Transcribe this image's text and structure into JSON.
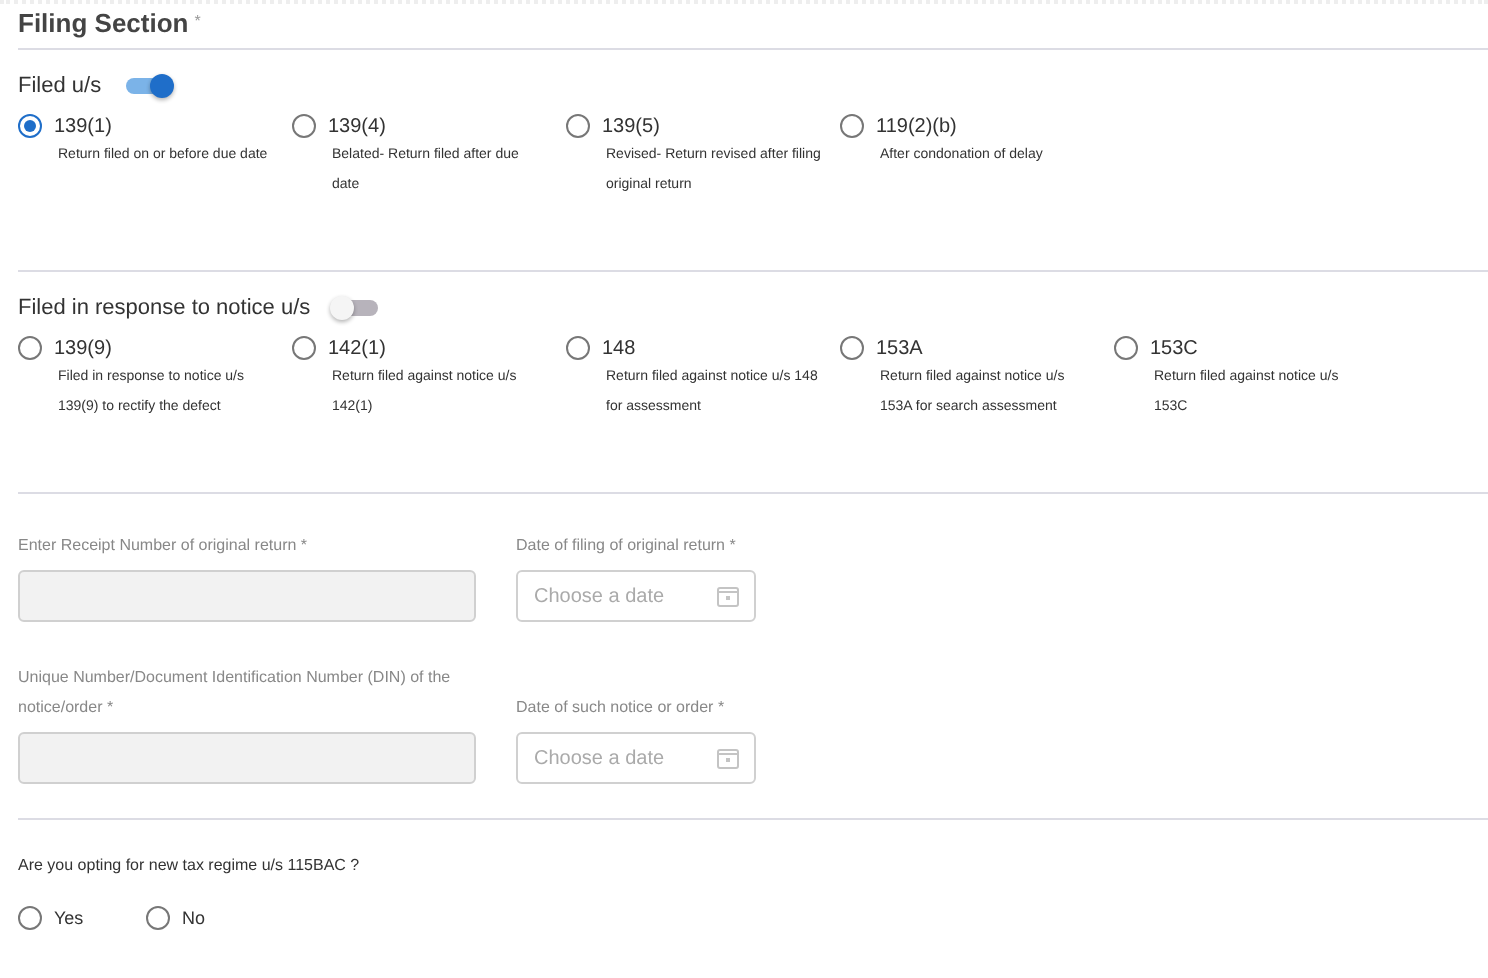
{
  "header": {
    "title": "Filing Section",
    "required_mark": "*"
  },
  "filed_us": {
    "label": "Filed u/s",
    "on": true,
    "options": [
      {
        "code": "139(1)",
        "description": "Return filed on or before due date",
        "selected": true
      },
      {
        "code": "139(4)",
        "description": "Belated- Return filed after due date",
        "selected": false
      },
      {
        "code": "139(5)",
        "description": "Revised- Return revised after filing original return",
        "selected": false
      },
      {
        "code": "119(2)(b)",
        "description": "After condonation of delay",
        "selected": false
      }
    ]
  },
  "notice": {
    "label": "Filed in response to notice u/s",
    "on": false,
    "options": [
      {
        "code": "139(9)",
        "description": "Filed in response to notice u/s 139(9) to rectify the defect",
        "selected": false
      },
      {
        "code": "142(1)",
        "description": "Return filed against notice u/s 142(1)",
        "selected": false
      },
      {
        "code": "148",
        "description": "Return filed against notice u/s 148 for assessment",
        "selected": false
      },
      {
        "code": "153A",
        "description": "Return filed against notice u/s 153A for search assessment",
        "selected": false
      },
      {
        "code": "153C",
        "description": "Return filed against notice u/s 153C",
        "selected": false
      }
    ]
  },
  "field_rows": [
    [
      {
        "kind": "text",
        "label": "Enter Receipt Number of original return *"
      },
      {
        "kind": "date",
        "label": "Date of filing of original return *",
        "placeholder": "Choose a date"
      }
    ],
    [
      {
        "kind": "text",
        "label": "Unique Number/Document Identification Number (DIN) of the notice/order *"
      },
      {
        "kind": "date",
        "label": "Date of such notice or order *",
        "placeholder": "Choose a date"
      }
    ]
  ],
  "tax_regime": {
    "question": "Are you opting for new tax regime u/s 115BAC ?",
    "options": [
      {
        "label": "Yes",
        "selected": false
      },
      {
        "label": "No",
        "selected": false
      }
    ]
  }
}
